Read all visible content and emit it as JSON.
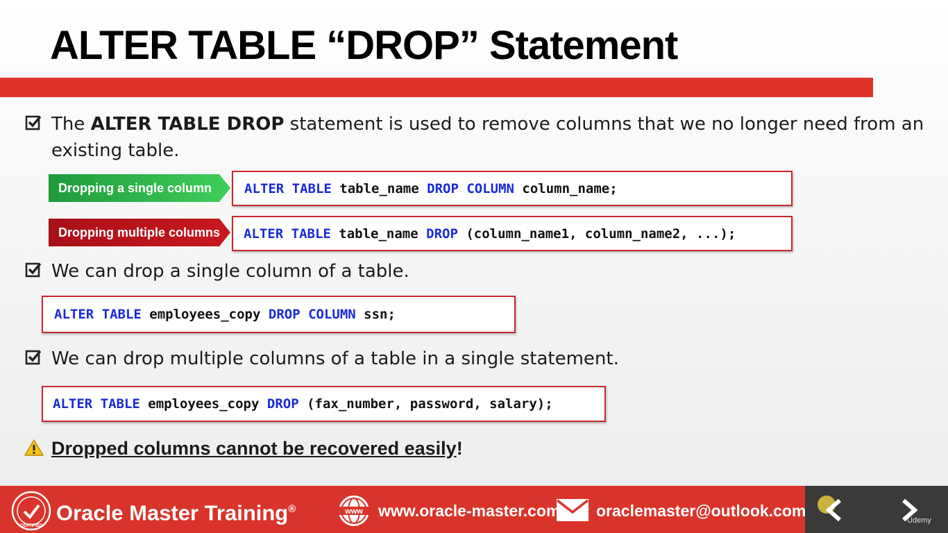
{
  "slide": {
    "title": "ALTER TABLE “DROP” Statement",
    "intro": {
      "prefix": "The ",
      "bold": "ALTER TABLE DROP",
      "suffix": " statement is used to remove columns that we no longer need from an",
      "line2": "existing table."
    },
    "syntax": [
      {
        "label": "Dropping a single column",
        "label_color": "#1f9a3b",
        "code": [
          {
            "t": "ALTER TABLE",
            "kw": true
          },
          {
            "t": " table_name ",
            "kw": false
          },
          {
            "t": "DROP COLUMN",
            "kw": true
          },
          {
            "t": " column_name;",
            "kw": false
          }
        ]
      },
      {
        "label": "Dropping multiple columns",
        "label_color": "#c8181e",
        "code": [
          {
            "t": "ALTER TABLE",
            "kw": true
          },
          {
            "t": " table_name ",
            "kw": false
          },
          {
            "t": "DROP",
            "kw": true
          },
          {
            "t": " (column_name1, column_name2, ...);",
            "kw": false
          }
        ]
      }
    ],
    "bullet2": "We can drop a single column of a table.",
    "example1": [
      {
        "t": "ALTER TABLE",
        "kw": true
      },
      {
        "t": " employees_copy ",
        "kw": false
      },
      {
        "t": "DROP COLUMN",
        "kw": true
      },
      {
        "t": " ssn;",
        "kw": false
      }
    ],
    "bullet3": "We can drop multiple columns of a table in a single statement.",
    "example2": [
      {
        "t": "ALTER TABLE",
        "kw": true
      },
      {
        "t": " employees_copy ",
        "kw": false
      },
      {
        "t": "DROP",
        "kw": true
      },
      {
        "t": " (fax_number, password, salary);",
        "kw": false
      }
    ],
    "warning": "Dropped columns cannot be recovered easily",
    "warning_mark": "!"
  },
  "footer": {
    "brand": "Oracle Master Training",
    "registered": "®",
    "badge_text": "CERTIFIED",
    "website": "www.oracle-master.com",
    "email": "oraclemaster@outlook.com",
    "www_icon_text": "www",
    "udemy": "Udemy"
  },
  "colors": {
    "accent_red": "#e1322a",
    "keyword_blue": "#1a2bd6",
    "footer_red": "#d9342b",
    "footer_dark": "#3a3a3a"
  }
}
